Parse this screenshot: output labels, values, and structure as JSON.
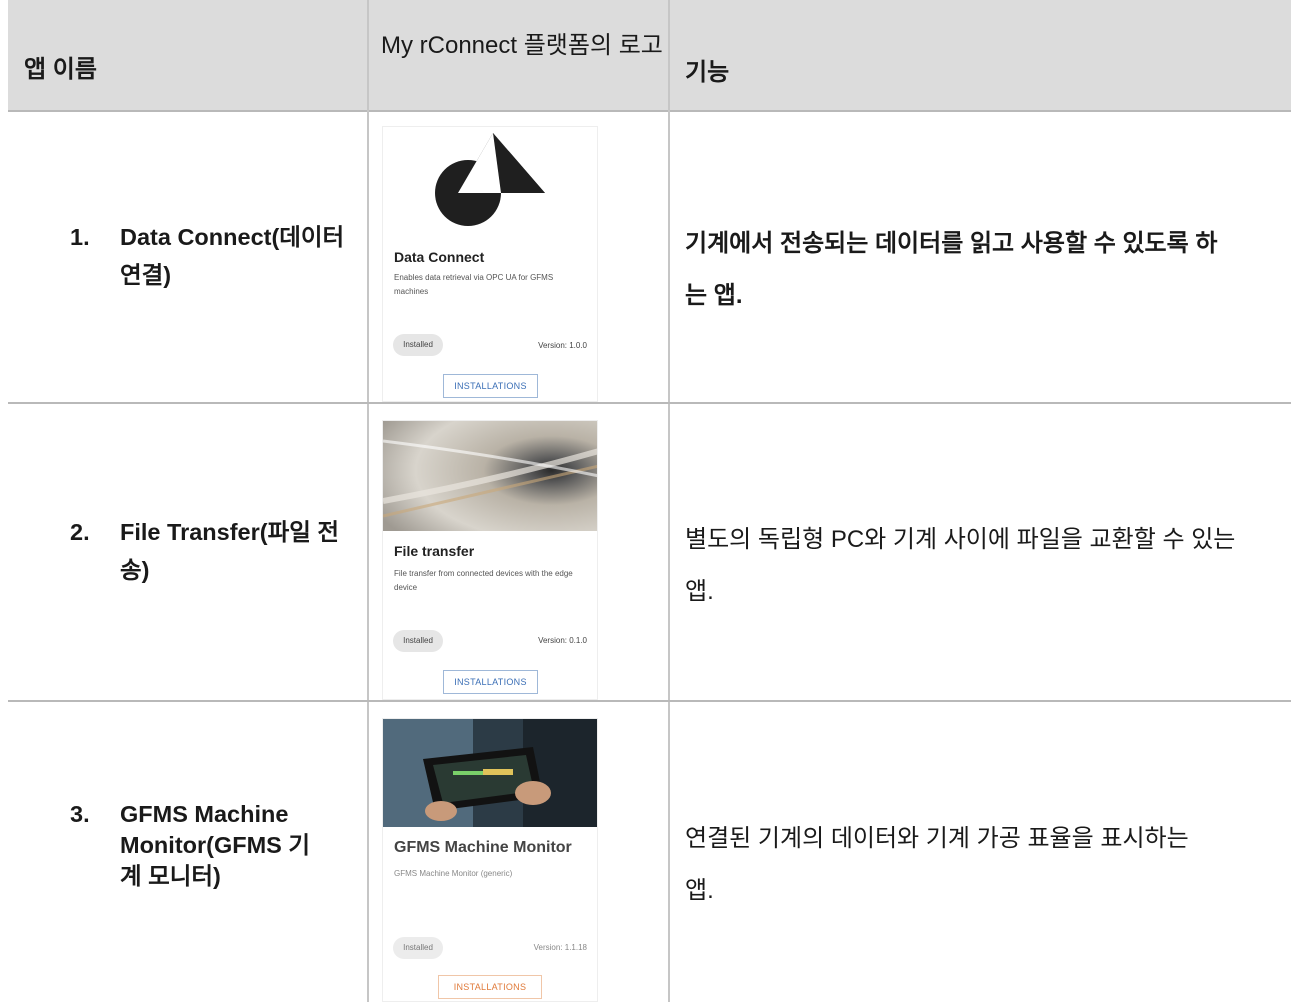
{
  "header": {
    "col_app_name": "앱 이름",
    "col_logo": "My rConnect 플랫폼의 로고",
    "col_function": "기능"
  },
  "rows": [
    {
      "number": "1.",
      "name": "Data Connect(데이터 연결)",
      "function": "기계에서 전송되는 데이터를 읽고 사용할 수 있도록 하는 앱.",
      "card": {
        "title": "Data Connect",
        "description": "Enables data retrieval via OPC UA for GFMS machines",
        "status": "Installed",
        "version": "Version: 1.0.0",
        "button": "INSTALLATIONS",
        "image": "geometric-logo"
      }
    },
    {
      "number": "2.",
      "name": "File Transfer(파일 전송)",
      "function": "별도의 독립형 PC와 기계 사이에 파일을 교환할 수 있는 앱.",
      "card": {
        "title": "File transfer",
        "description": "File transfer from connected devices with the edge device",
        "status": "Installed",
        "version": "Version: 0.1.0",
        "button": "INSTALLATIONS",
        "image": "tunnel-photo"
      }
    },
    {
      "number": "3.",
      "name": "GFMS Machine Monitor(GFMS 기계 모니터)",
      "function": "연결된 기계의 데이터와 기계 가공 표율을 표시하는 앱.",
      "card": {
        "title": "GFMS Machine Monitor",
        "description": "GFMS Machine Monitor (generic)",
        "status": "Installed",
        "version": "Version: 1.1.18",
        "button": "INSTALLATIONS",
        "image": "tablet-photo"
      }
    }
  ],
  "colors": {
    "header_bg": "#dcdcdc",
    "grid_line": "#b9b9b9",
    "button_blue": "#3b6fb6",
    "button_orange": "#e07a3a"
  }
}
